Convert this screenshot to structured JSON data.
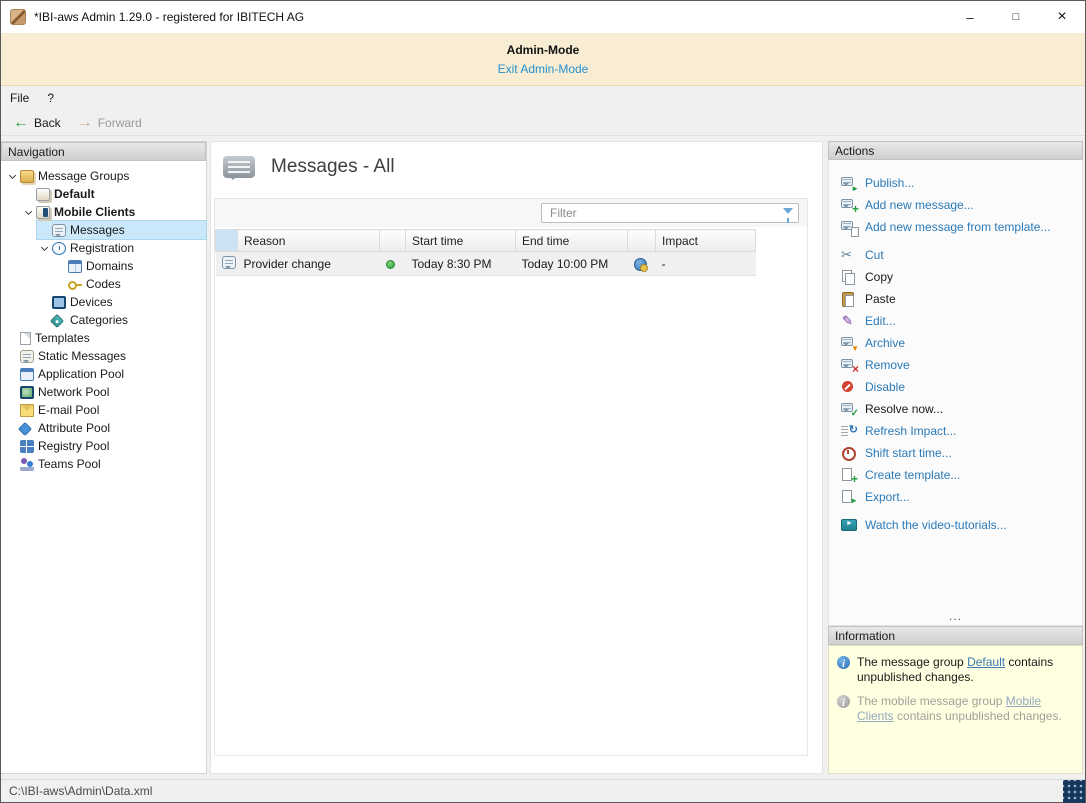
{
  "window": {
    "title": "*IBI-aws Admin 1.29.0 - registered for IBITECH AG",
    "minimize_glyph": "–",
    "maximize_glyph": "□",
    "close_glyph": "×"
  },
  "colors": {
    "link": "#2a7ab9",
    "banner_bg": "#f8edd3",
    "tree_selection": "#cbe8fa",
    "info_bg": "#ffffe1",
    "status_ok_green": "#3fae49"
  },
  "admin_banner": {
    "title": "Admin-Mode",
    "exit_link": "Exit Admin-Mode"
  },
  "menubar": {
    "items": [
      "File",
      "?"
    ]
  },
  "toolbar": {
    "back_label": "Back",
    "forward_label": "Forward"
  },
  "navigation": {
    "header": "Navigation",
    "tree": [
      {
        "label": "Message Groups",
        "level": 0,
        "expander": "open",
        "icon": "message-groups",
        "bold": false,
        "selected": false
      },
      {
        "label": "Default",
        "level": 1,
        "expander": "closed",
        "icon": "group-default",
        "bold": true,
        "selected": false
      },
      {
        "label": "Mobile Clients",
        "level": 1,
        "expander": "open",
        "icon": "mobile-clients",
        "bold": true,
        "selected": false
      },
      {
        "label": "Messages",
        "level": 2,
        "expander": "closed",
        "icon": "messages",
        "bold": false,
        "selected": true
      },
      {
        "label": "Registration",
        "level": 2,
        "expander": "open",
        "icon": "registration",
        "bold": false,
        "selected": false
      },
      {
        "label": "Domains",
        "level": 3,
        "expander": "none",
        "icon": "domains",
        "bold": false,
        "selected": false
      },
      {
        "label": "Codes",
        "level": 3,
        "expander": "none",
        "icon": "codes",
        "bold": false,
        "selected": false
      },
      {
        "label": "Devices",
        "level": 2,
        "expander": "none",
        "icon": "devices",
        "bold": false,
        "selected": false
      },
      {
        "label": "Categories",
        "level": 2,
        "expander": "closed",
        "icon": "categories",
        "bold": false,
        "selected": false
      },
      {
        "label": "Templates",
        "level": 0,
        "expander": "none",
        "icon": "templates",
        "bold": false,
        "selected": false
      },
      {
        "label": "Static Messages",
        "level": 0,
        "expander": "none",
        "icon": "static-messages",
        "bold": false,
        "selected": false
      },
      {
        "label": "Application Pool",
        "level": 0,
        "expander": "closed",
        "icon": "application-pool",
        "bold": false,
        "selected": false
      },
      {
        "label": "Network Pool",
        "level": 0,
        "expander": "closed",
        "icon": "network-pool",
        "bold": false,
        "selected": false
      },
      {
        "label": "E-mail Pool",
        "level": 0,
        "expander": "closed",
        "icon": "email-pool",
        "bold": false,
        "selected": false
      },
      {
        "label": "Attribute Pool",
        "level": 0,
        "expander": "closed",
        "icon": "attribute-pool",
        "bold": false,
        "selected": false
      },
      {
        "label": "Registry Pool",
        "level": 0,
        "expander": "closed",
        "icon": "registry-pool",
        "bold": false,
        "selected": false
      },
      {
        "label": "Teams Pool",
        "level": 0,
        "expander": "closed",
        "icon": "teams-pool",
        "bold": false,
        "selected": false
      }
    ]
  },
  "main": {
    "title": "Messages - All",
    "filter": {
      "placeholder": "Filter"
    },
    "table": {
      "headers": {
        "reason": "Reason",
        "start": "Start time",
        "end": "End time",
        "impact": "Impact"
      },
      "rows": [
        {
          "reason": "Provider change",
          "status": "active",
          "start": "Today 8:30 PM",
          "end": "Today 10:00 PM",
          "impact": "-"
        }
      ]
    }
  },
  "actions": {
    "header": "Actions",
    "overflow": "...",
    "items": [
      {
        "label": "Publish...",
        "icon": "publish",
        "enabled": true,
        "gap_before": false
      },
      {
        "label": "Add new message...",
        "icon": "add-message",
        "enabled": true,
        "gap_before": false
      },
      {
        "label": "Add new message from template...",
        "icon": "add-from-template",
        "enabled": true,
        "gap_before": false
      },
      {
        "label": "Cut",
        "icon": "cut",
        "enabled": true,
        "gap_before": true
      },
      {
        "label": "Copy",
        "icon": "copy",
        "enabled": false,
        "gap_before": false
      },
      {
        "label": "Paste",
        "icon": "paste",
        "enabled": false,
        "gap_before": false
      },
      {
        "label": "Edit...",
        "icon": "edit",
        "enabled": true,
        "gap_before": false
      },
      {
        "label": "Archive",
        "icon": "archive",
        "enabled": true,
        "gap_before": false
      },
      {
        "label": "Remove",
        "icon": "remove",
        "enabled": true,
        "gap_before": false
      },
      {
        "label": "Disable",
        "icon": "disable",
        "enabled": true,
        "gap_before": false
      },
      {
        "label": "Resolve now...",
        "icon": "resolve",
        "enabled": false,
        "gap_before": false
      },
      {
        "label": "Refresh Impact...",
        "icon": "refresh-impact",
        "enabled": true,
        "gap_before": false
      },
      {
        "label": "Shift start time...",
        "icon": "shift-start-time",
        "enabled": true,
        "gap_before": false
      },
      {
        "label": "Create template...",
        "icon": "create-template",
        "enabled": true,
        "gap_before": false
      },
      {
        "label": "Export...",
        "icon": "export",
        "enabled": true,
        "gap_before": false
      },
      {
        "label": "Watch the video-tutorials...",
        "icon": "video-tutorials",
        "enabled": true,
        "gap_before": true
      }
    ]
  },
  "information": {
    "header": "Information",
    "items": [
      {
        "prefix": "The message group ",
        "link": "Default",
        "suffix": " contains unpublished changes.",
        "muted": false
      },
      {
        "prefix": "The mobile message group ",
        "link": "Mobile Clients",
        "suffix": " contains unpublished changes.",
        "muted": true
      }
    ]
  },
  "statusbar": {
    "path": "C:\\IBI-aws\\Admin\\Data.xml"
  }
}
